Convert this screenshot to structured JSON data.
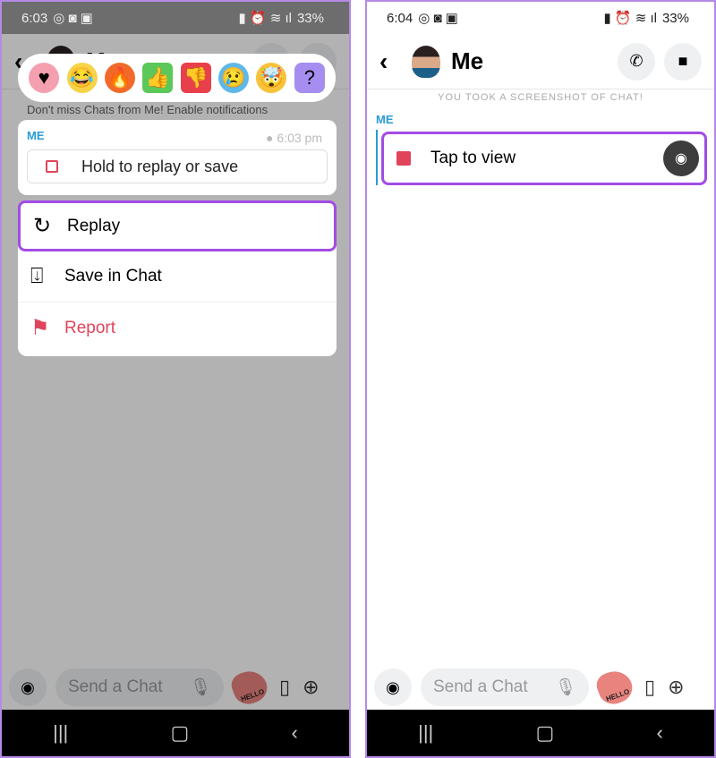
{
  "left": {
    "status": {
      "time": "6:03",
      "battery": "33%"
    },
    "header": {
      "title": "Me"
    },
    "reactions": [
      "heart",
      "crying-laughing",
      "fire",
      "thumbs-up",
      "thumbs-down",
      "crying",
      "mind-blown",
      "question"
    ],
    "notice": "Don't miss Chats from Me! Enable notifications",
    "card": {
      "sender": "ME",
      "time": "6:03 pm",
      "snap_label": "Hold to replay or save"
    },
    "menu": [
      {
        "label": "Replay",
        "icon": "replay-icon"
      },
      {
        "label": "Save in Chat",
        "icon": "save-icon"
      },
      {
        "label": "Report",
        "icon": "flag-icon"
      }
    ],
    "composer": {
      "placeholder": "Send a Chat",
      "sticker": "HELLO"
    }
  },
  "right": {
    "status": {
      "time": "6:04",
      "battery": "33%"
    },
    "header": {
      "title": "Me"
    },
    "system_message": "YOU TOOK A SCREENSHOT OF CHAT!",
    "sender": "ME",
    "snap_label": "Tap to view",
    "composer": {
      "placeholder": "Send a Chat",
      "sticker": "HELLO"
    }
  },
  "colors": {
    "accent_highlight": "#a24ce6",
    "snap_red": "#e0445a",
    "sender_blue": "#2a9bd6"
  }
}
